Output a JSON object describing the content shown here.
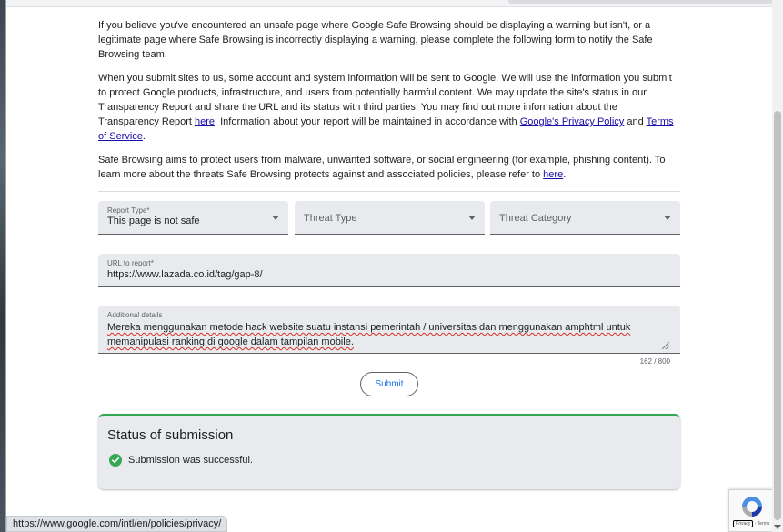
{
  "intro": {
    "p1": "If you believe you've encountered an unsafe page where Google Safe Browsing should be displaying a warning but isn't, or a legitimate page where Safe Browsing is incorrectly displaying a warning, please complete the following form to notify the Safe Browsing team.",
    "p2_before_here": "When you submit sites to us, some account and system information will be sent to Google. We will use the information you submit to protect Google products, infrastructure, and users from potentially harmful content. We may update the site's status in our Transparency Report and share the URL and its status with third parties. You may find out more information about the Transparency Report ",
    "p2_here_link": "here",
    "p2_middle": ". Information about your report will be maintained in accordance with ",
    "privacy_policy_link": "Google's Privacy Policy",
    "p2_and": " and ",
    "terms_link": "Terms of Service",
    "p2_end": ".",
    "p3_before_here": "Safe Browsing aims to protect users from malware, unwanted software, or social engineering (for example, phishing content). To learn more about the threats Safe Browsing protects against and associated policies, please refer to ",
    "p3_here_link": "here",
    "p3_end": "."
  },
  "form": {
    "report_type": {
      "label": "Report Type*",
      "value": "This page is not safe"
    },
    "threat_type": {
      "placeholder": "Threat Type"
    },
    "threat_category": {
      "placeholder": "Threat Category"
    },
    "url": {
      "label": "URL to report*",
      "value": "https://www.lazada.co.id/tag/gap-8/"
    },
    "details": {
      "label": "Additional details",
      "value": "Mereka menggunakan metode hack website suatu instansi pemerintah / universitas dan menggunakan amphtml untuk memanipulasi ranking di google dalam tampilan mobile.",
      "counter": "162 / 800"
    },
    "submit_label": "Submit"
  },
  "status": {
    "title": "Status of submission",
    "message": "Submission was successful.",
    "color": "#34a853"
  },
  "link_preview": "https://www.google.com/intl/en/policies/privacy/",
  "recaptcha": {
    "privacy": "Privacy",
    "separator": " - ",
    "terms": "Terms"
  }
}
